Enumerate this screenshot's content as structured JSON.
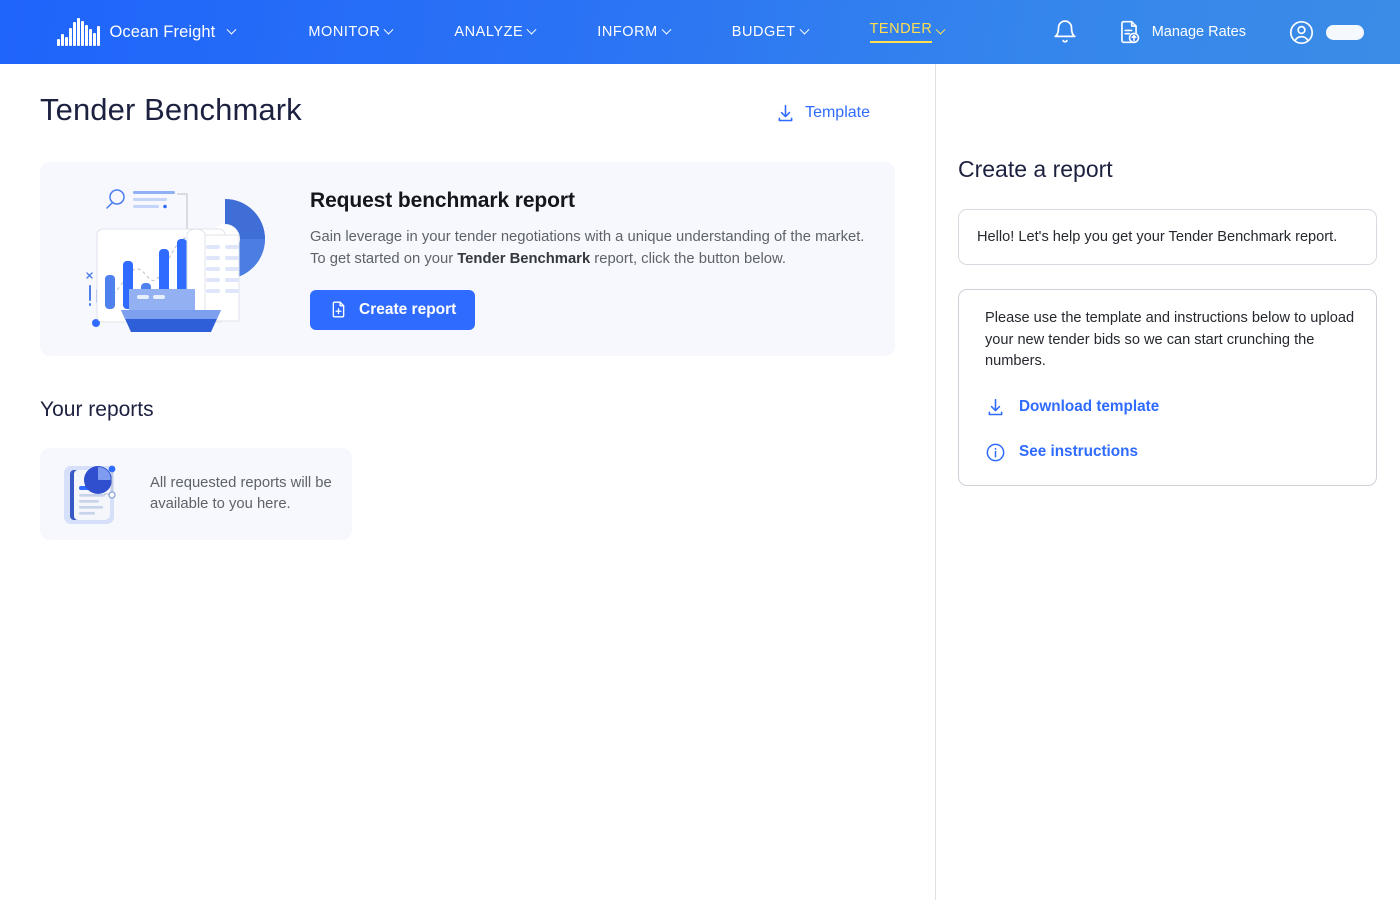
{
  "header": {
    "brand": {
      "name": "Ocean Freight",
      "logo_icon": "waveform-logo-icon",
      "caret_icon": "chevron-down-icon"
    },
    "nav": [
      {
        "label": "MONITOR",
        "active": false
      },
      {
        "label": "ANALYZE",
        "active": false
      },
      {
        "label": "INFORM",
        "active": false
      },
      {
        "label": "BUDGET",
        "active": false
      },
      {
        "label": "TENDER",
        "active": true
      }
    ],
    "notifications_icon": "bell-icon",
    "manage_rates": {
      "label": "Manage Rates",
      "icon": "document-upload-icon"
    },
    "account": {
      "icon": "user-circle-icon",
      "name_placeholder": ""
    },
    "colors": {
      "gradient_start": "#1f64fb",
      "gradient_end": "#3b8ce6",
      "active_nav": "#ffdf4f"
    }
  },
  "main": {
    "page_title": "Tender Benchmark",
    "template_link": {
      "label": "Template",
      "icon": "download-icon"
    },
    "hero": {
      "illustration": "analytics-ship-illustration",
      "title": "Request benchmark report",
      "desc_line1": "Gain leverage in your tender negotiations with a unique understanding of the market.",
      "desc_line2_pre": "To get started on your ",
      "desc_line2_bold": "Tender Benchmark",
      "desc_line2_post": " report, click the button below.",
      "cta": {
        "label": "Create report",
        "icon": "document-plus-icon"
      }
    },
    "reports": {
      "section_title": "Your reports",
      "empty_state": {
        "icon": "document-pie-chart-icon",
        "line1": "All requested reports will be",
        "line2": "available to you here."
      }
    }
  },
  "sidebar": {
    "title": "Create a report",
    "chat_message": "Hello! Let's help you get your Tender Benchmark report.",
    "instructions": {
      "line1": "Please use the template and instructions below to upload",
      "line2": "your new tender bids so we can start crunching the",
      "line3": "numbers."
    },
    "actions": [
      {
        "label": "Download template",
        "icon": "download-icon"
      },
      {
        "label": "See instructions",
        "icon": "info-circle-icon"
      }
    ]
  },
  "colors": {
    "accent_blue": "#2f6bff",
    "title_navy": "#1d2140",
    "card_bg": "#f7f8fd",
    "body_text": "#5d626b"
  }
}
